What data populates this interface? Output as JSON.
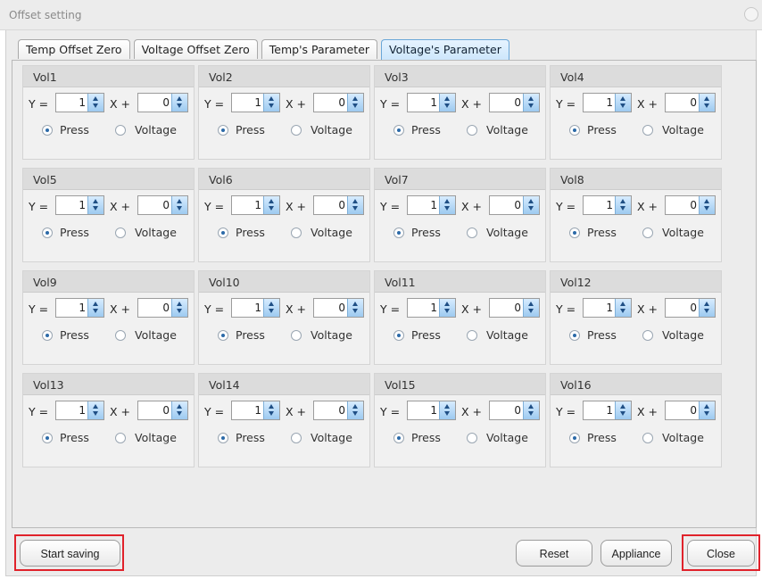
{
  "window": {
    "title": "Offset setting"
  },
  "tabs": [
    {
      "label": "Temp Offset Zero",
      "active": false
    },
    {
      "label": "Voltage Offset Zero",
      "active": false
    },
    {
      "label": "Temp's Parameter",
      "active": false
    },
    {
      "label": "Voltage's Parameter",
      "active": true
    }
  ],
  "common": {
    "y_label": "Y =",
    "x_label": "X +",
    "radio_press": "Press",
    "radio_voltage": "Voltage"
  },
  "groups": [
    {
      "name": "Vol1",
      "y": "1",
      "x": "0",
      "selected": "Press"
    },
    {
      "name": "Vol2",
      "y": "1",
      "x": "0",
      "selected": "Press"
    },
    {
      "name": "Vol3",
      "y": "1",
      "x": "0",
      "selected": "Press"
    },
    {
      "name": "Vol4",
      "y": "1",
      "x": "0",
      "selected": "Press"
    },
    {
      "name": "Vol5",
      "y": "1",
      "x": "0",
      "selected": "Press"
    },
    {
      "name": "Vol6",
      "y": "1",
      "x": "0",
      "selected": "Press"
    },
    {
      "name": "Vol7",
      "y": "1",
      "x": "0",
      "selected": "Press"
    },
    {
      "name": "Vol8",
      "y": "1",
      "x": "0",
      "selected": "Press"
    },
    {
      "name": "Vol9",
      "y": "1",
      "x": "0",
      "selected": "Press"
    },
    {
      "name": "Vol10",
      "y": "1",
      "x": "0",
      "selected": "Press"
    },
    {
      "name": "Vol11",
      "y": "1",
      "x": "0",
      "selected": "Press"
    },
    {
      "name": "Vol12",
      "y": "1",
      "x": "0",
      "selected": "Press"
    },
    {
      "name": "Vol13",
      "y": "1",
      "x": "0",
      "selected": "Press"
    },
    {
      "name": "Vol14",
      "y": "1",
      "x": "0",
      "selected": "Press"
    },
    {
      "name": "Vol15",
      "y": "1",
      "x": "0",
      "selected": "Press"
    },
    {
      "name": "Vol16",
      "y": "1",
      "x": "0",
      "selected": "Press"
    }
  ],
  "footer": {
    "start_saving": "Start saving",
    "reset": "Reset",
    "appliance": "Appliance",
    "close": "Close"
  },
  "colors": {
    "highlight": "#e0222b",
    "active_tab": "#cce6fb",
    "spin_arrow": "#9dcaf0"
  }
}
